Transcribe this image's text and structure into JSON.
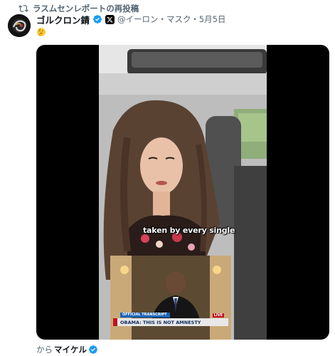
{
  "repost": {
    "text": "ラスムセンレポートの再投稿",
    "icon": "repost-icon"
  },
  "post": {
    "avatar_icon": "gorgon-avatar",
    "author_name": "ゴルクロン錆",
    "handle_line": "@イーロン・マスク・5月5日",
    "verified_icon": "verified-badge-icon",
    "affiliate_icon": "x-logo-icon",
    "body_emoji": "thinking-face-emoji"
  },
  "media": {
    "caption": "taken by every single",
    "inset": {
      "label": "OFFICIAL TRANSCRIPT",
      "banner": "OBAMA: THIS IS NOT AMNESTY",
      "live": "LIVE"
    }
  },
  "from": {
    "prefix": "から",
    "name": "マイケル",
    "verified_icon": "verified-badge-icon"
  },
  "colors": {
    "verified_blue": "#1d9bf0",
    "muted_text": "#536471",
    "primary_text": "#0f1419"
  }
}
